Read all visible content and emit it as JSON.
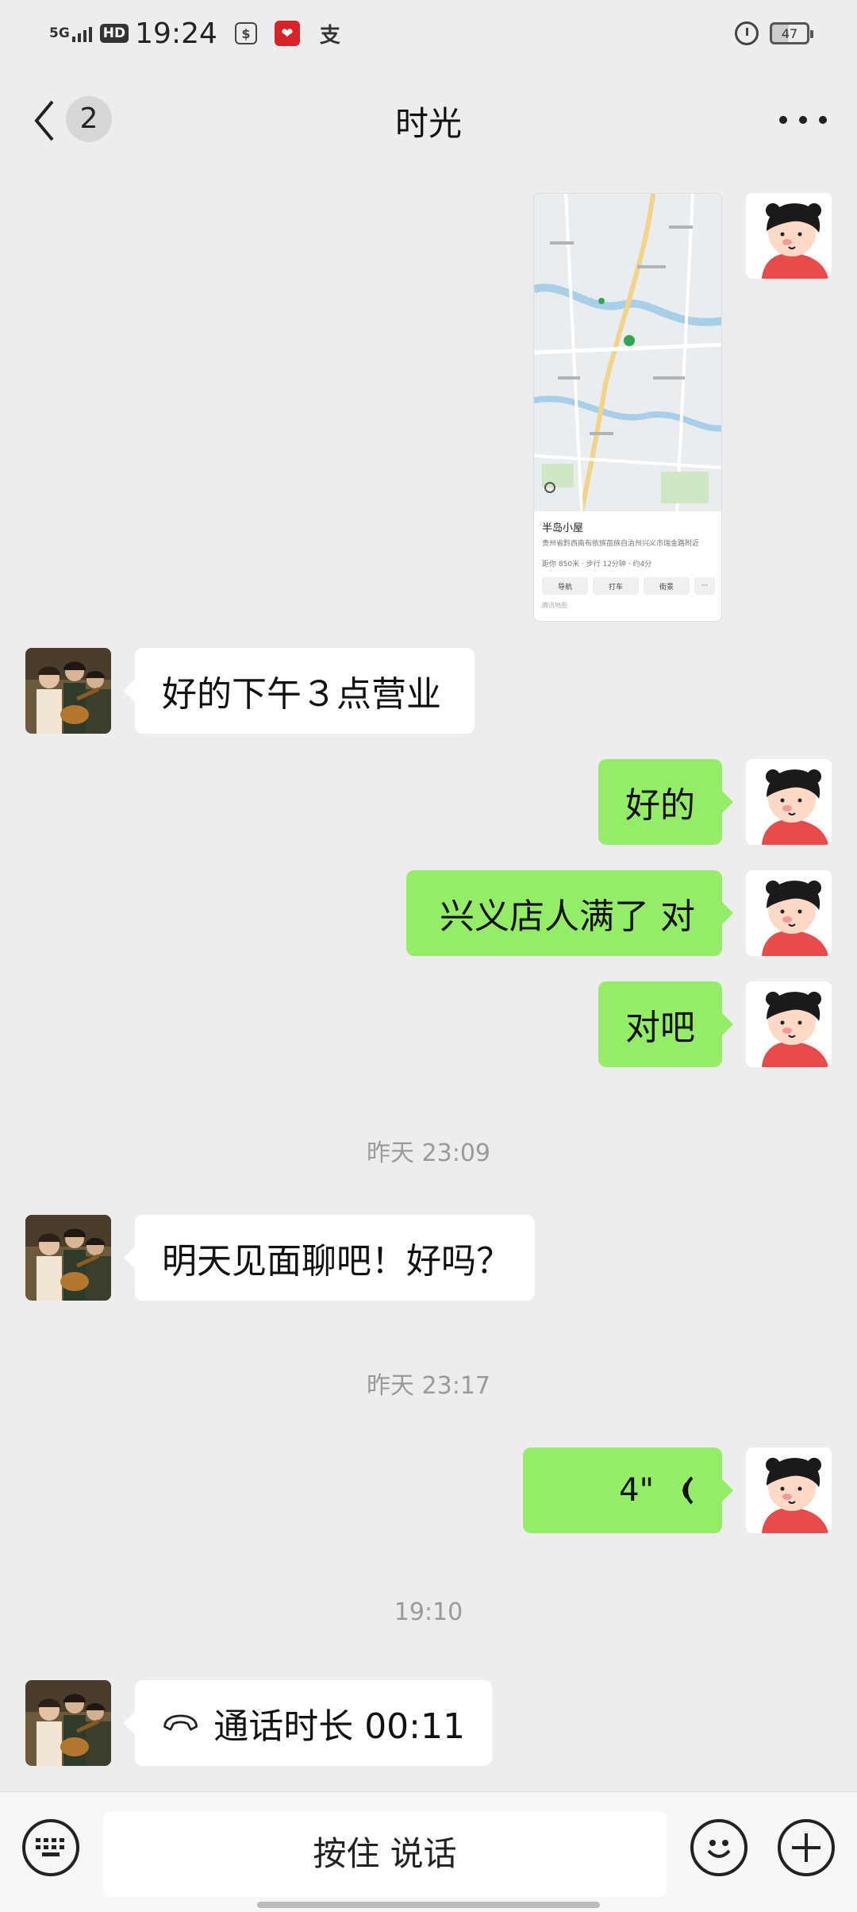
{
  "status_bar": {
    "network": "5G",
    "hd": "HD",
    "time": "19:24",
    "app_icon_3": "支",
    "battery": "47"
  },
  "nav": {
    "unread_count": "2",
    "title": "时光"
  },
  "messages": [
    {
      "type": "location",
      "direction": "out"
    },
    {
      "type": "text",
      "direction": "in",
      "text": "好的下午３点营业"
    },
    {
      "type": "text",
      "direction": "out",
      "text": "好的"
    },
    {
      "type": "text",
      "direction": "out",
      "text": "兴义店人满了 对"
    },
    {
      "type": "text",
      "direction": "out",
      "text": "对吧"
    },
    {
      "type": "timestamp",
      "text": "昨天 23:09"
    },
    {
      "type": "text",
      "direction": "in",
      "text": "明天见面聊吧！好吗？"
    },
    {
      "type": "timestamp",
      "text": "昨天 23:17"
    },
    {
      "type": "voice",
      "direction": "out",
      "duration": "4\""
    },
    {
      "type": "timestamp",
      "text": "19:10"
    },
    {
      "type": "call",
      "direction": "in",
      "text": "通话时长 00:11"
    }
  ],
  "location_card": {
    "name": "半岛小屋",
    "address": "贵州省黔西南布依族苗族自治州兴义市瑞金路附近",
    "meta": "距你 850米 · 步行 12分钟 · 约4分",
    "actions": [
      "导航",
      "打车",
      "街景",
      "···"
    ],
    "footer": "腾讯地图"
  },
  "bottom_bar": {
    "hold_to_talk": "按住 说话"
  },
  "icons": {
    "back": "chevron-left-icon",
    "more": "more-dots-icon",
    "keyboard": "keyboard-icon",
    "emoji": "emoji-icon",
    "plus": "plus-icon",
    "voice": "voice-wave-icon",
    "call": "phone-hangup-icon"
  },
  "colors": {
    "background": "#ededed",
    "bubble_out": "#95ec69",
    "bubble_in": "#ffffff",
    "timestamp": "#9a9a9a"
  }
}
